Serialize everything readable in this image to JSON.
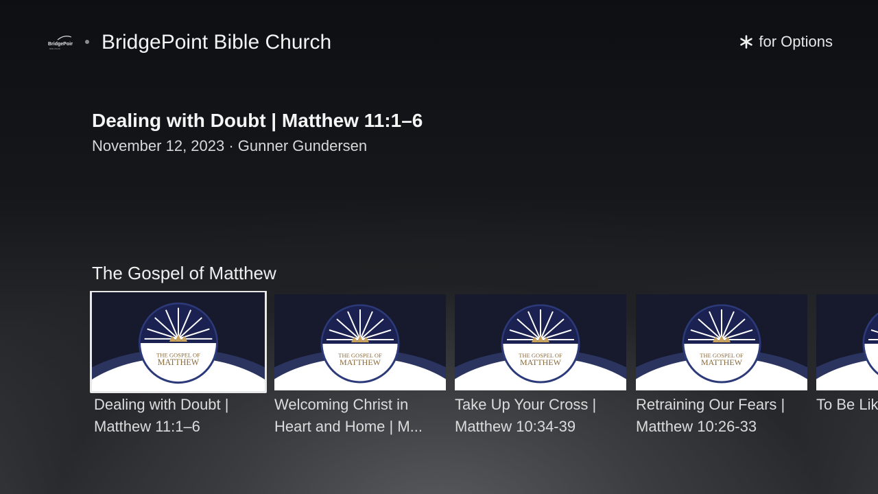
{
  "header": {
    "logo_text": "BridgePoint",
    "channel_title": "BridgePoint Bible Church",
    "options_label": "for Options",
    "options_icon": "asterisk-icon"
  },
  "details": {
    "title": "Dealing with Doubt | Matthew 11:1–6",
    "meta": "November 12, 2023 · Gunner Gundersen"
  },
  "row": {
    "title": "The Gospel of Matthew",
    "thumbnail_text_top": "THE GOSPEL OF",
    "thumbnail_text_main": "MATTHEW",
    "items": [
      {
        "label": "Dealing with Doubt | Matthew 11:1–6",
        "focused": true
      },
      {
        "label": "Welcoming Christ in Heart and Home | M...",
        "focused": false
      },
      {
        "label": "Take Up Your Cross | Matthew 10:34-39",
        "focused": false
      },
      {
        "label": "Retraining Our Fears | Matthew 10:26-33",
        "focused": false
      },
      {
        "label": "To Be Like... Matthew",
        "focused": false
      }
    ]
  }
}
